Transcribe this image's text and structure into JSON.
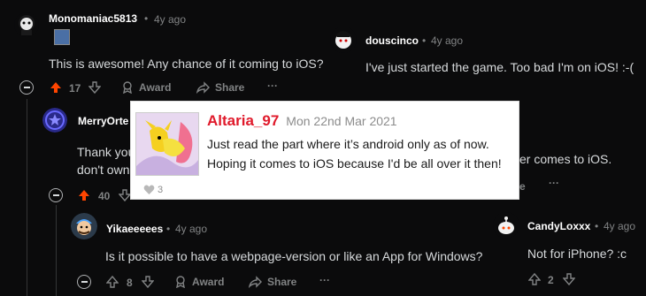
{
  "comments": {
    "c1": {
      "user": "Monomaniac5813",
      "time": "4y ago",
      "text": "This is awesome! Any chance of it coming to iOS?",
      "votes": "17",
      "award": "Award",
      "share": "Share",
      "more": "···"
    },
    "c2": {
      "user": "MerryOrte",
      "text1": "Thank you",
      "text2": "don't own",
      "votes": "40"
    },
    "c3": {
      "user": "Yikaeeeees",
      "time": "4y ago",
      "text": "Is it possible to have a webpage-version or like an App for Windows?",
      "votes": "8",
      "award": "Award",
      "share": "Share",
      "more": "···"
    },
    "c4": {
      "user": "douscinco",
      "time": "4y ago",
      "text": "I've just started the game. Too bad I'm on iOS! :-("
    },
    "c5": {
      "fragment": "er comes to iOS.",
      "share_frag": "e",
      "more": "···"
    },
    "c6": {
      "user": "CandyLoxxx",
      "time": "4y ago",
      "text": "Not for iPhone? :c",
      "votes": "2"
    }
  },
  "separator": "•",
  "popup": {
    "name": "Altaria_97",
    "date": "Mon 22nd Mar 2021",
    "line1": "Just read the part where it’s android only as of now.",
    "line2": "Hoping it comes to iOS because I'd be all over it then!",
    "likes": "3"
  },
  "colors": {
    "upvote": "#ff4500",
    "popup_name": "#e01a2b"
  }
}
